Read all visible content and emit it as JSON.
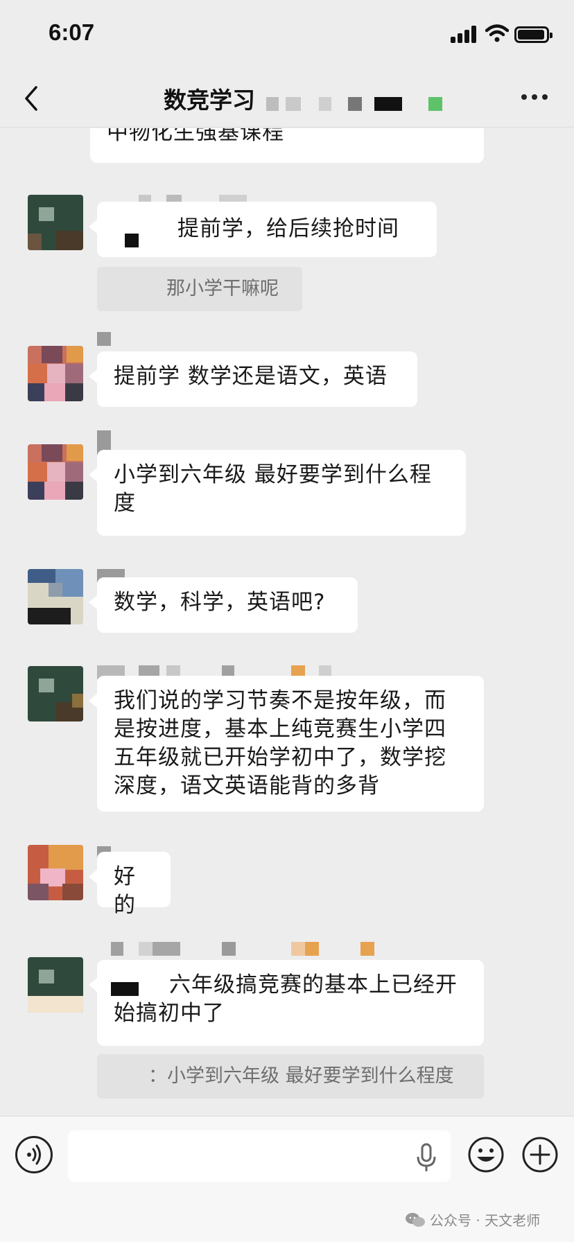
{
  "status_bar": {
    "time": "6:07"
  },
  "nav": {
    "title": "数竞学习"
  },
  "messages": {
    "m0": {
      "text": "中物化生强基课程"
    },
    "m1": {
      "text": "提前学，给后续抢时间",
      "quote": "那小学干嘛呢"
    },
    "m2": {
      "text": "提前学 数学还是语文，英语"
    },
    "m3": {
      "text": "小学到六年级 最好要学到什么程度"
    },
    "m4": {
      "text": "数学，科学，英语吧?"
    },
    "m5": {
      "text": "我们说的学习节奏不是按年级，而是按进度，基本上纯竞赛生小学四五年级就已开始学初中了，数学挖深度，语文英语能背的多背"
    },
    "m6": {
      "text": "好的"
    },
    "m7": {
      "text": "六年级搞竞赛的基本上已经开始搞初中了",
      "quote": "：小学到六年级 最好要学到什么程度"
    }
  },
  "input": {
    "placeholder": ""
  },
  "watermark": {
    "text": "公众号 · 天文老师"
  },
  "colors": {
    "background": "#ededed",
    "bubble": "#ffffff",
    "quote_bg": "#e2e2e2",
    "accent_green": "#5ec269"
  }
}
